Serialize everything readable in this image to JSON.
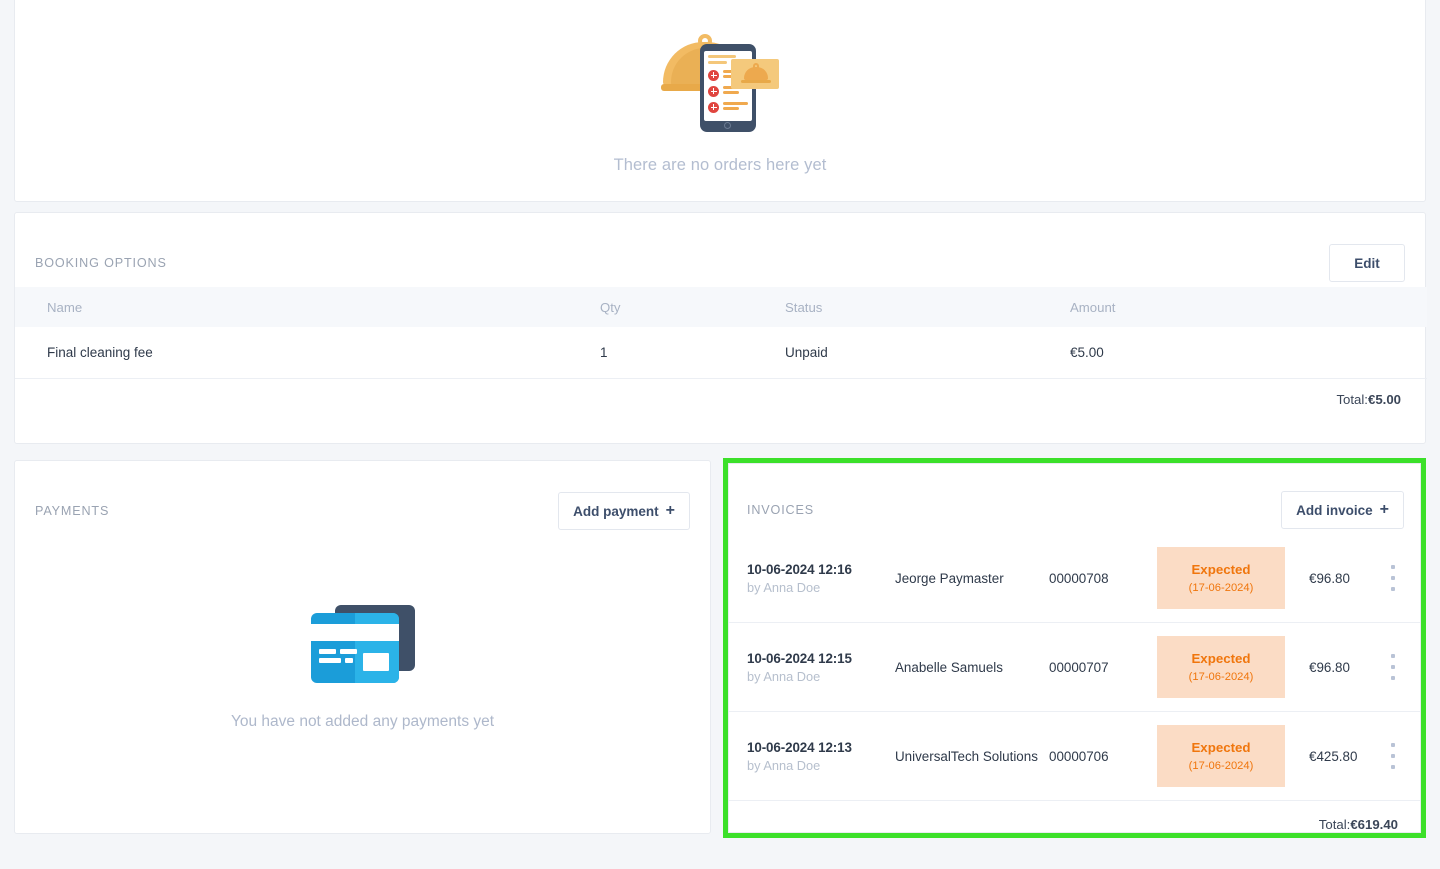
{
  "orders": {
    "empty_text": "There are no orders here yet",
    "illustration": "food-order-illustration"
  },
  "booking_options": {
    "title": "BOOKING OPTIONS",
    "edit_label": "Edit",
    "columns": [
      "Name",
      "Qty",
      "Status",
      "Amount"
    ],
    "rows": [
      {
        "name": "Final cleaning fee",
        "qty": "1",
        "status": "Unpaid",
        "amount": "€5.00"
      }
    ],
    "total_label": "Total:",
    "total_value": "€5.00"
  },
  "payments": {
    "title": "PAYMENTS",
    "add_label": "Add payment",
    "add_plus": "+",
    "empty_text": "You have not added any payments yet",
    "illustration": "credit-cards-illustration"
  },
  "invoices": {
    "title": "INVOICES",
    "add_label": "Add invoice",
    "add_plus": "+",
    "highlight_color": "#3ce02a",
    "badge_bg": "#fbdcc5",
    "badge_color": "#f0760d",
    "rows": [
      {
        "date": "10-06-2024 12:16",
        "author": "by Anna Doe",
        "client": "Jeorge Paymaster",
        "number": "00000708",
        "status": "Expected",
        "status_date": "(17-06-2024)",
        "amount": "€96.80"
      },
      {
        "date": "10-06-2024 12:15",
        "author": "by Anna Doe",
        "client": "Anabelle Samuels",
        "number": "00000707",
        "status": "Expected",
        "status_date": "(17-06-2024)",
        "amount": "€96.80"
      },
      {
        "date": "10-06-2024 12:13",
        "author": "by Anna Doe",
        "client": "UniversalTech Solutions",
        "number": "00000706",
        "status": "Expected",
        "status_date": "(17-06-2024)",
        "amount": "€425.80"
      }
    ],
    "total_label": "Total:",
    "total_value": "€619.40"
  }
}
